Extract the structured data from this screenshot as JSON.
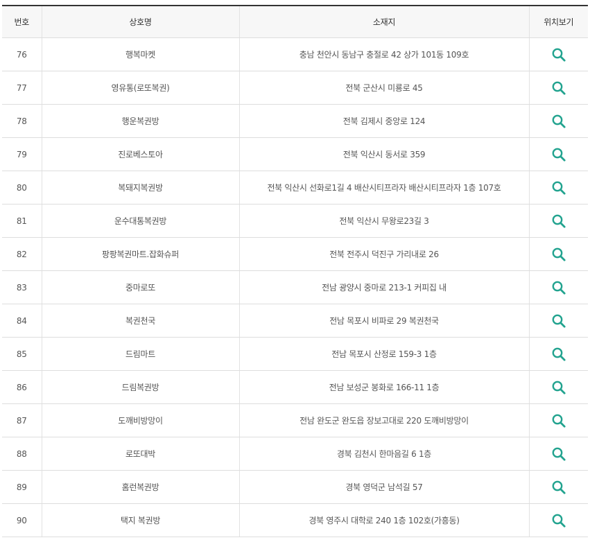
{
  "colors": {
    "icon": "#22a38f",
    "header_bg": "#f7f7f7",
    "top_border": "#333333",
    "row_border": "#dddddd"
  },
  "table": {
    "headers": {
      "no": "번호",
      "name": "상호명",
      "address": "소재지",
      "map": "위치보기"
    },
    "map_icon": "search-icon",
    "rows": [
      {
        "no": "76",
        "name": "행복마켓",
        "address": "충남 천안시 동남구 충절로 42 상가 101동 109호"
      },
      {
        "no": "77",
        "name": "영유통(로또복권)",
        "address": "전북 군산시 미룡로 45"
      },
      {
        "no": "78",
        "name": "행운복권방",
        "address": "전북 김제시 중앙로 124"
      },
      {
        "no": "79",
        "name": "진로베스토아",
        "address": "전북 익산시 동서로 359"
      },
      {
        "no": "80",
        "name": "복돼지복권방",
        "address": "전북 익산시 선화로1길 4 배산시티프라자 배산시티프라자 1층 107호"
      },
      {
        "no": "81",
        "name": "운수대통복권방",
        "address": "전북 익산시 무왕로23길 3"
      },
      {
        "no": "82",
        "name": "팡팡복권마트.잡화슈퍼",
        "address": "전북 전주시 덕진구 가리내로 26"
      },
      {
        "no": "83",
        "name": "중마로또",
        "address": "전남 광양시 중마로 213-1 커피집 내"
      },
      {
        "no": "84",
        "name": "복권천국",
        "address": "전남 목포시 비파로 29 복권천국"
      },
      {
        "no": "85",
        "name": "드림마트",
        "address": "전남 목포시 산정로 159-3 1층"
      },
      {
        "no": "86",
        "name": "드림복권방",
        "address": "전남 보성군 봉화로 166-11 1층"
      },
      {
        "no": "87",
        "name": "도깨비방망이",
        "address": "전남 완도군 완도읍 장보고대로 220 도깨비방망이"
      },
      {
        "no": "88",
        "name": "로또대박",
        "address": "경북 김천시 한마음길 6 1층"
      },
      {
        "no": "89",
        "name": "홈런복권방",
        "address": "경북 영덕군 남석길 57"
      },
      {
        "no": "90",
        "name": "택지 복권방",
        "address": "경북 영주시 대학로 240 1층 102호(가흥동)"
      }
    ]
  }
}
